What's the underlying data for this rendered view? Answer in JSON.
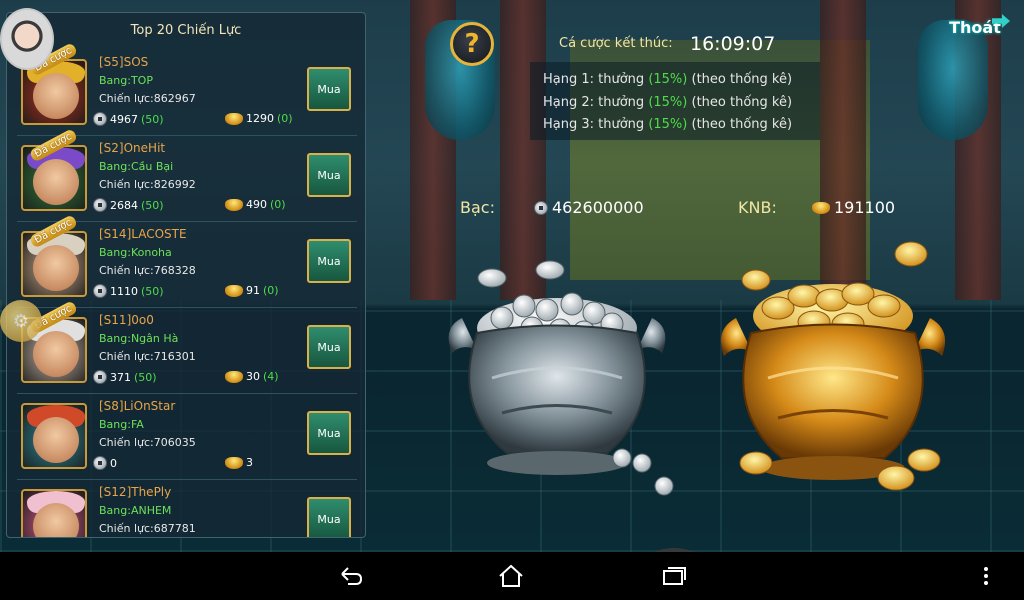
{
  "panel": {
    "title": "Top 20 Chiến Lực",
    "bet_tag": "Đã cược",
    "buy_label": "Mua",
    "players": [
      {
        "name": "[S5]SOS",
        "guild": "Bang:TOP",
        "power": "Chiến lực:862967",
        "silver": "4967",
        "silver_extra": "(50)",
        "gold": "1290",
        "gold_extra": "(0)",
        "has_bet": true,
        "theme": "#b3321e",
        "hat": "#e3b02a"
      },
      {
        "name": "[S2]OneHit",
        "guild": "Bang:Cầu Bại",
        "power": "Chiến lực:826992",
        "silver": "2684",
        "silver_extra": "(50)",
        "gold": "490",
        "gold_extra": "(0)",
        "has_bet": true,
        "theme": "#2f7a3a",
        "hat": "#7a4ac8"
      },
      {
        "name": "[S14]LACOSTE",
        "guild": "Bang:Konoha",
        "power": "Chiến lực:768328",
        "silver": "1110",
        "silver_extra": "(50)",
        "gold": "91",
        "gold_extra": "(0)",
        "has_bet": true,
        "theme": "#c9a98a",
        "hat": "#d8d0c0"
      },
      {
        "name": "[S11]0o0",
        "guild": "Bang:Ngân Hà",
        "power": "Chiến lực:716301",
        "silver": "371",
        "silver_extra": "(50)",
        "gold": "30",
        "gold_extra": "(4)",
        "has_bet": true,
        "theme": "#c9b8a8",
        "hat": "#e0e0e0"
      },
      {
        "name": "[S8]LiOnStar",
        "guild": "Bang:FA",
        "power": "Chiến lực:706035",
        "silver": "0",
        "silver_extra": "",
        "gold": "3",
        "gold_extra": "",
        "has_bet": false,
        "theme": "#2a8a9a",
        "hat": "#d04a2a"
      },
      {
        "name": "[S12]ThePly",
        "guild": "Bang:ANHEM",
        "power": "Chiến lực:687781",
        "silver": "",
        "silver_extra": "",
        "gold": "",
        "gold_extra": "",
        "has_bet": false,
        "theme": "#d85a8a",
        "hat": "#f0c0d0"
      }
    ]
  },
  "header": {
    "help_symbol": "?",
    "bet_end_label": "Cá cược kết thúc:",
    "bet_end_time": "16:09:07",
    "exit_label": "Thoát",
    "ranks": [
      {
        "prefix": "Hạng 1: thưởng ",
        "percent": "(15%)",
        "suffix": " (theo thống kê)"
      },
      {
        "prefix": "Hạng 2: thưởng ",
        "percent": "(15%)",
        "suffix": " (theo thống kê)"
      },
      {
        "prefix": "Hạng 3: thưởng ",
        "percent": "(15%)",
        "suffix": " (theo thống kê)"
      }
    ]
  },
  "pool": {
    "silver_label": "Bạc:",
    "silver_value": "462600000",
    "knb_label": "KNB:",
    "knb_value": "191100"
  },
  "colors": {
    "name": "#e8a54a",
    "guild": "#6ee05a",
    "percent": "#4fdc4a",
    "accent_gold": "#e6b43a"
  },
  "icons": {
    "silver": "silver-coin-icon",
    "gold": "gold-ingot-icon",
    "help": "question-icon",
    "exit": "exit-arrow-icon",
    "nav": [
      "back-icon",
      "home-icon",
      "recent-apps-icon",
      "menu-dots-icon"
    ]
  }
}
